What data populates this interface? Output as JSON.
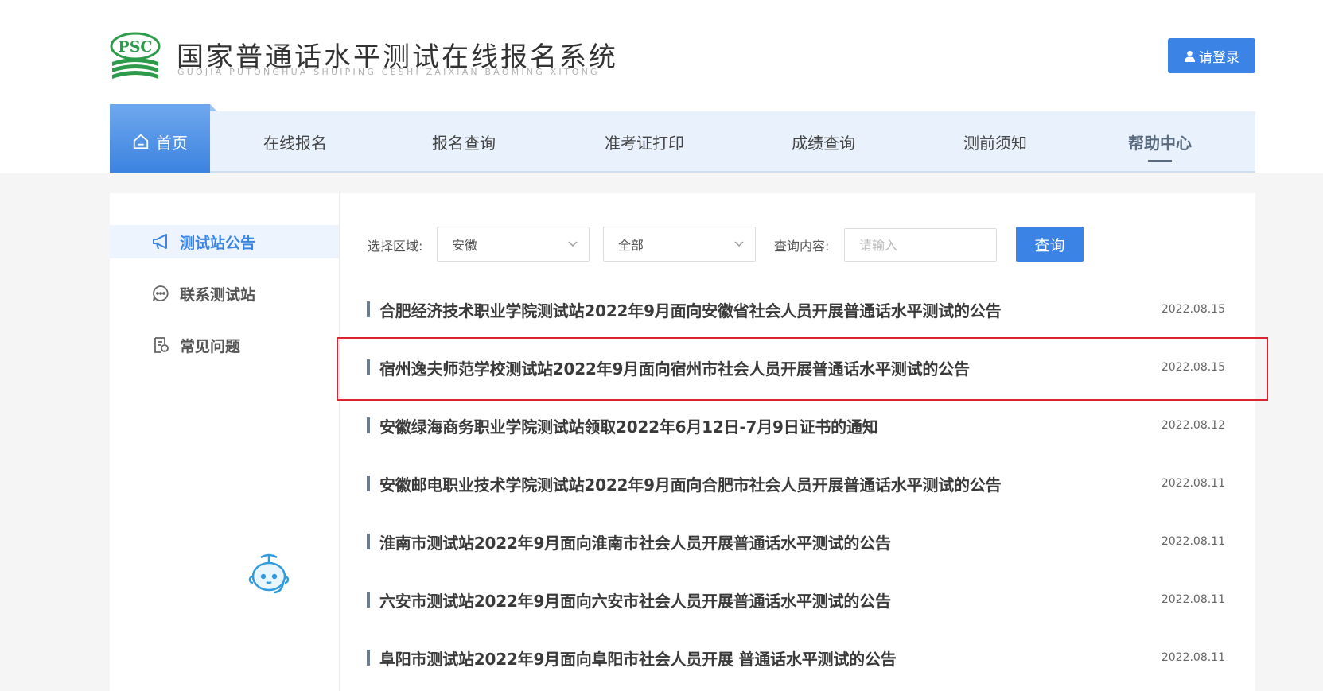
{
  "header": {
    "logo_text": "PSC",
    "title": "国家普通话水平测试在线报名系统",
    "subtitle": "GUOJIA PUTONGHUA SHUIPING CESHI ZAIXIAN BAOMING XITONG",
    "login_label": "请登录"
  },
  "nav": {
    "home_label": "首页",
    "items": [
      {
        "label": "在线报名"
      },
      {
        "label": "报名查询"
      },
      {
        "label": "准考证打印"
      },
      {
        "label": "成绩查询"
      },
      {
        "label": "测前须知"
      },
      {
        "label": "帮助中心"
      }
    ],
    "active_index": 5
  },
  "sidebar": {
    "items": [
      {
        "label": "测试站公告",
        "icon": "megaphone-icon",
        "active": true
      },
      {
        "label": "联系测试站",
        "icon": "chat-icon",
        "active": false
      },
      {
        "label": "常见问题",
        "icon": "document-question-icon",
        "active": false
      }
    ]
  },
  "filters": {
    "region_label": "选择区域:",
    "region_value": "安徽",
    "city_value": "全部",
    "query_label": "查询内容:",
    "query_placeholder": "请输入",
    "search_label": "查询"
  },
  "notices": [
    {
      "title": "合肥经济技术职业学院测试站2022年9月面向安徽省社会人员开展普通话水平测试的公告",
      "date": "2022.08.15"
    },
    {
      "title": "宿州逸夫师范学校测试站2022年9月面向宿州市社会人员开展普通话水平测试的公告",
      "date": "2022.08.15",
      "highlighted": true
    },
    {
      "title": "安徽绿海商务职业学院测试站领取2022年6月12日-7月9日证书的通知",
      "date": "2022.08.12"
    },
    {
      "title": "安徽邮电职业技术学院测试站2022年9月面向合肥市社会人员开展普通话水平测试的公告",
      "date": "2022.08.11"
    },
    {
      "title": "淮南市测试站2022年9月面向淮南市社会人员开展普通话水平测试的公告",
      "date": "2022.08.11"
    },
    {
      "title": "六安市测试站2022年9月面向六安市社会人员开展普通话水平测试的公告",
      "date": "2022.08.11"
    },
    {
      "title": "阜阳市测试站2022年9月面向阜阳市社会人员开展 普通话水平测试的公告",
      "date": "2022.08.11"
    }
  ],
  "colors": {
    "primary": "#3b84e6",
    "nav_bg": "#e8f1fc",
    "highlight_border": "#d9232d",
    "logo_green": "#2e9b4a"
  }
}
